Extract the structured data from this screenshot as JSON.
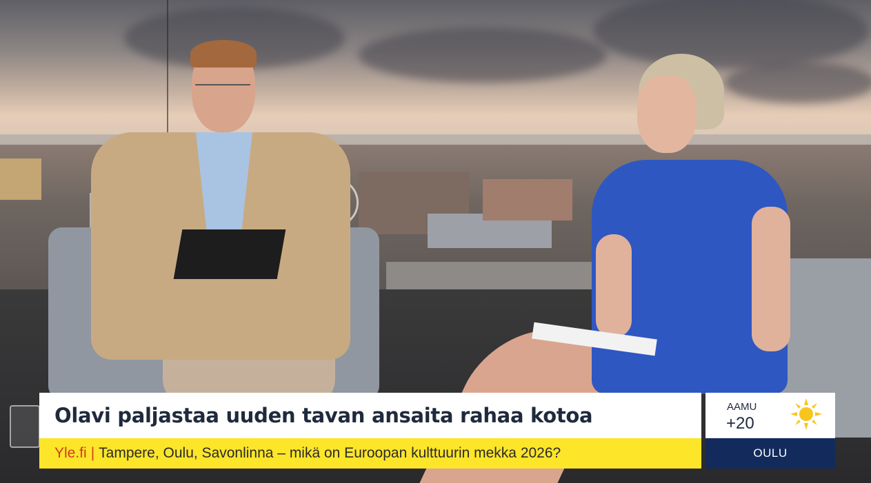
{
  "lower_third": {
    "headline": "Olavi paljastaa uuden tavan ansaita rahaa kotoa",
    "ticker_source": "Yle.fi",
    "ticker_separator": "|",
    "ticker_text": "Tampere, Oulu, Savonlinna – mikä on Euroopan kulttuurin mekka 2026?"
  },
  "weather": {
    "period": "AAMU",
    "temperature": "+20",
    "city": "OULU",
    "icon": "sun-icon"
  },
  "colors": {
    "headline_bg": "#ffffff",
    "headline_text": "#1f2a3d",
    "ticker_bg": "#fde52a",
    "ticker_source": "#d23c1c",
    "weather_city_bg": "#132a5c",
    "sun": "#f7c51d"
  }
}
